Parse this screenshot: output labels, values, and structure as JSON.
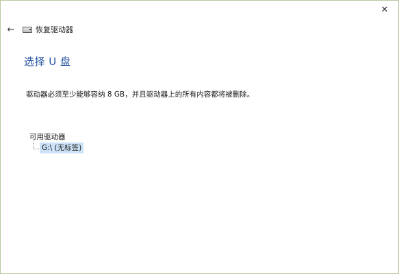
{
  "window": {
    "close_glyph": "✕"
  },
  "header": {
    "back_glyph": "←",
    "icon": "usb-drive-icon",
    "title": "恢复驱动器"
  },
  "main": {
    "heading": "选择 U 盘",
    "description": "驱动器必须至少能够容纳 8 GB，并且驱动器上的所有内容都将被删除。",
    "drives_label": "可用驱动器",
    "drives": [
      {
        "label": "G:\\ (无标签)",
        "selected": true
      }
    ]
  },
  "colors": {
    "heading": "#1e4fa0",
    "selection": "#cce3f7",
    "border": "#b8c8a0"
  }
}
